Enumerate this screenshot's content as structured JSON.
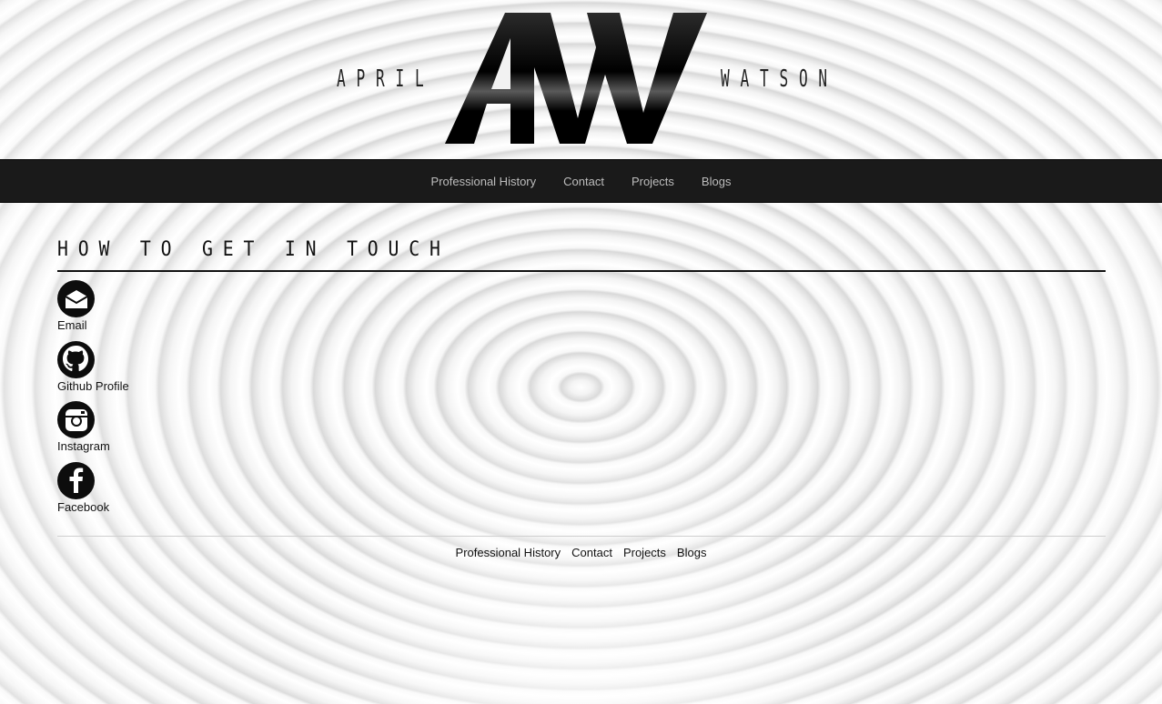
{
  "logo": {
    "left_word": "APRIL",
    "right_word": "WATSON",
    "monogram": "AW"
  },
  "nav": {
    "items": [
      {
        "label": "Professional History"
      },
      {
        "label": "Contact"
      },
      {
        "label": "Projects"
      },
      {
        "label": "Blogs"
      }
    ]
  },
  "main": {
    "title": "HOW TO GET IN TOUCH",
    "contacts": [
      {
        "label": "Email",
        "icon": "email-icon"
      },
      {
        "label": "Github Profile",
        "icon": "github-icon"
      },
      {
        "label": "Instagram",
        "icon": "instagram-icon"
      },
      {
        "label": "Facebook",
        "icon": "facebook-icon"
      }
    ]
  },
  "footer": {
    "items": [
      {
        "label": "Professional History"
      },
      {
        "label": "Contact"
      },
      {
        "label": "Projects"
      },
      {
        "label": "Blogs"
      }
    ]
  },
  "colors": {
    "navbar_bg": "#1a1a1a",
    "nav_text": "#bdbdbd",
    "text": "#111111",
    "icon_bg": "#0d0d0d"
  }
}
